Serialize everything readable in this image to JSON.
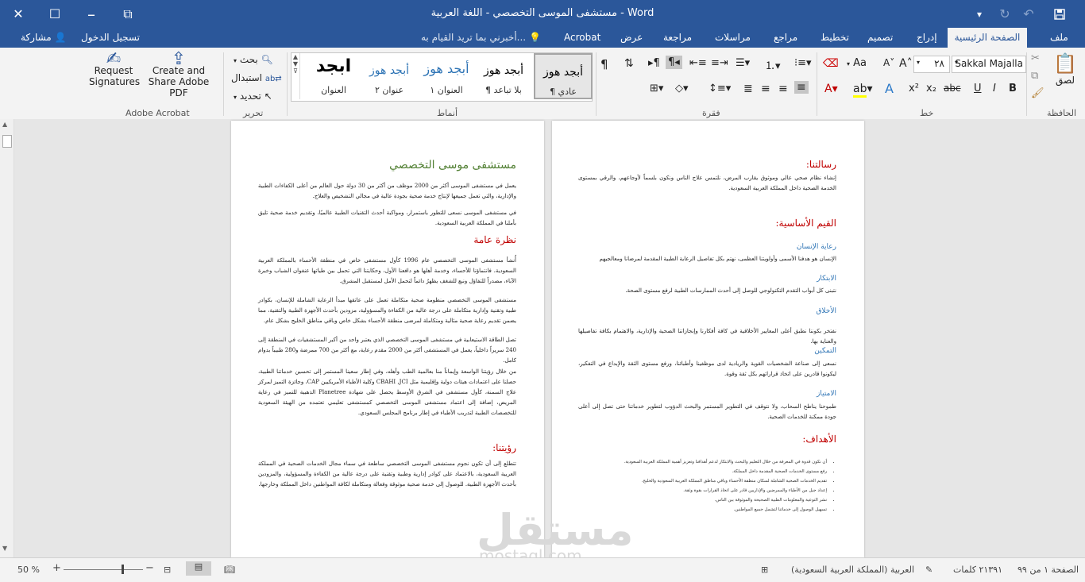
{
  "window": {
    "title": "مستشفى الموسى التخصصي - اللغة العربية - Word"
  },
  "tabs": {
    "file": "ملف",
    "home": "الصفحة الرئيسية",
    "insert": "إدراج",
    "design": "تصميم",
    "layout": "تخطيط",
    "references": "مراجع",
    "mailings": "مراسلات",
    "review": "مراجعة",
    "view": "عرض",
    "acrobat": "Acrobat",
    "tell_me": "أخبرني بما تريد القيام به...",
    "sign_in": "تسجيل الدخول",
    "share": "مشاركة"
  },
  "ribbon": {
    "clipboard": {
      "label": "الحافظة",
      "paste": "لصق"
    },
    "font": {
      "label": "خط",
      "font_name": "Sakkal Majalla",
      "font_size": "٢٨",
      "bold": "B",
      "italic": "I",
      "underline": "U",
      "strike": "abc",
      "subscript": "x₂",
      "superscript": "x²",
      "case": "Aa"
    },
    "paragraph": {
      "label": "فقرة"
    },
    "styles": {
      "label": "أنماط",
      "items": [
        {
          "sample": "أبجد هوز",
          "name": "¶ عادي"
        },
        {
          "sample": "أبجد هوز",
          "name": "¶ بلا تباعد"
        },
        {
          "sample": "أبجد هوز",
          "name": "العنوان ١"
        },
        {
          "sample": "أبجد هوز",
          "name": "عنوان ٢"
        },
        {
          "sample": "ابجد",
          "name": "العنوان"
        }
      ]
    },
    "editing": {
      "label": "تحرير",
      "find": "بحث",
      "replace": "استبدال",
      "select": "تحديد"
    },
    "acrobat": {
      "label": "Adobe Acrobat",
      "create_share": "Create and Share Adobe PDF",
      "request_sig": "Request Signatures"
    }
  },
  "left_page": {
    "title": "مستشفى موسى التخصصي",
    "intro1": "يعمل في مستشفى الموسى أكثر من 2000 موظف من أكثر من 30 دولة حول العالم من أعلى الكفاءات الطبية والإدارية، والتي تعمل جميعها لإنتاج خدمة صحية بجودة عالية في مجالي التشخيص والعلاج.",
    "intro2": "في مستشفى الموسى نسعى للتطور باستمرار، ومواكبة أحدث التقنيات الطبية عالميًا، وتقديم خدمة صحية تليق بأملنا في المملكة العربية السعودية.",
    "overview_heading": "نظرة عامة",
    "overview1": "أُنشأ مستشفى الموسى التخصصي عام 1996 كأول مستشفى خاص في منطقة الأحساء بالمملكة العربية السعودية. فانتماؤنا للأحساء، وخدمة أهلها هو دافعنا الأول، وحكايتنا التي تحمل بين طياتها عنفوان الشباب وخبرة الآباء، مصدراً للتفاؤل ونبع للشغف يظهرُ دائماً لتحمل الأمل لمستقبل المشرق.",
    "overview2": "مستشفى الموسى التخصصي منظومة صحية متكاملة تعمل على عاتقها مبدأ الرعاية الشاملة للإنسان، بكوادر طبية وتقنية وإدارية متكاملة على درجة عالية من الكفاءة والمسؤولية، مزودين بأحدث الأجهزة الطبية والتقنية، مما يضمن تقديم رعاية صحية مثالية ومتكاملة لمرضى منطقة الأحساء بشكل خاص وباقي مناطق الخليج بشكل عام.",
    "overview3": "تصل الطاقة الاستيعابية في مستشفى الموسى التخصصي الذي يعتبر واحد من أكبر المستشفيات في المنطقة إلى 240 سريراً داخلياً، يعمل في المستشفى أكثر من 2000 مقدم رعاية، مع أكثر من 700 ممرضة و280 طبيباً بدوام كامل.",
    "overview4": "من خلال رؤيتنا الواسعة وإيماناً منا بعالمية الطب وأهله، وفي إطار سعينا المستمر إلى تحسين خدماتنا الطبية، حصلنا على اعتمادات هيئات دولية وإقليمية مثل CBAHI ,JCI وكلية الأطباء الأمريكيين CAP، وجائزة التميز لمركز علاج السمنة، كأول مستشفى في الشرق الأوسط يحصل على شهادة Planetree الذهبية للتميز في رعاية المريض، إضافة إلى اعتماد مستشفى الموسى التخصصي كمستشفى تعليمي تعتمده من الهيئة السعودية للتخصصات الطبية لتدريب الأطباء في إطار برنامج المجلس السعودي.",
    "vision_heading": "رؤيتنا:",
    "vision": "تتطلع إلى أن تكون نجوم مستشفى الموسى التخصصي ساطعة في سماء مجال الخدمات الصحية في المملكة العربية السعودية، بالاعتماد على كوادر إدارية وطبية وتقنية على درجة عالية من الكفاءة والمسؤولية، والمزودين بأحدث الأجهزة الطبية. للوصول إلى خدمة صحية موثوقة وفعالة ومتكاملة لكافة المواطنين داخل المملكة وخارجها."
  },
  "right_page": {
    "mission_heading": "رسالتنا:",
    "mission": "إنشاء نظام صحي عالي وموثوق يقارب المرض، نلتمس علاج الناس ونكون بلسماً لأوجاعهم، والرقي بمستوى الخدمة الصحية داخل المملكة العربية السعودية.",
    "values_heading": "القيم الأساسية:",
    "values": [
      {
        "title": "رعاية الإنسان",
        "text": "الإنسان هو هدفنا الأسمى وأولويتنا العظمى، نهتم بكل تفاصيل الرعاية الطبية المقدمة لمرضانا ومعالجيهم"
      },
      {
        "title": "الابتكار",
        "text": "نتبنى كل أبواب التقدم التكنولوجي للوصل إلى أحدث الممارسات الطبية لرفع مستوى الصحة."
      },
      {
        "title": "الأخلاق",
        "text": "نفتخر بكوننا نطبق أعلى المعايير الأخلاقية في كافة أفكارنا وإنجازاتنا الصحية والإدارية، والاهتمام بكافة تفاصيلها والعناية بها."
      },
      {
        "title": "التمكين",
        "text": "نسعى إلى صناعة الشخصيات القوية والريادية لدى موظفينا وأطبائنا، ورفع مستوى الثقة والإبداع في التفكير، ليكونوا قادرين على اتخاذ قراراتهم بكل ثقة وقوة."
      },
      {
        "title": "الامتياز",
        "text": "طموحنا يناطح السحاب، ولا نتوقف في التطوير المستمر والبحث الدؤوب لتطوير خدماتنا حتى تصل إلى أعلى جودة ممكنة للخدمات الصحية."
      }
    ],
    "goals_heading": "الأهداف:",
    "goals": [
      "أن نكون قدوة في المعرفة من خلال التعليم والبحث والابتكار لدعم أهدافنا وتعزيز أهمية المملكة العربية السعودية.",
      "رفع مستوى الخدمات الصحية المقدمة داخل المملكة.",
      "تقديم الخدمات الصحية الشاملة لسكان منطقة الأحساء وباقي مناطق المملكة العربية السعودية والخليج.",
      "إعداد جيل من الأطباء والممرضين والإداريين قادر على اتخاذ القرارات بقوة وثقة.",
      "نشر التوعية والمعلومات الطبية الصحيحة والموثوقة بين الناس.",
      "تسهيل الوصول إلى خدماتنا لتشمل جميع المواطنين."
    ]
  },
  "status": {
    "page": "الصفحة ١ من ٩٩",
    "words": "٢١٣٩١ كلمات",
    "language": "العربية (المملكة العربية السعودية)",
    "zoom": "50 %"
  },
  "watermark": {
    "main": "مستقل",
    "sub": "mostaql.com"
  },
  "colors": {
    "brand": "#2b579a",
    "heading_green": "#538135",
    "heading_red": "#c00000"
  }
}
